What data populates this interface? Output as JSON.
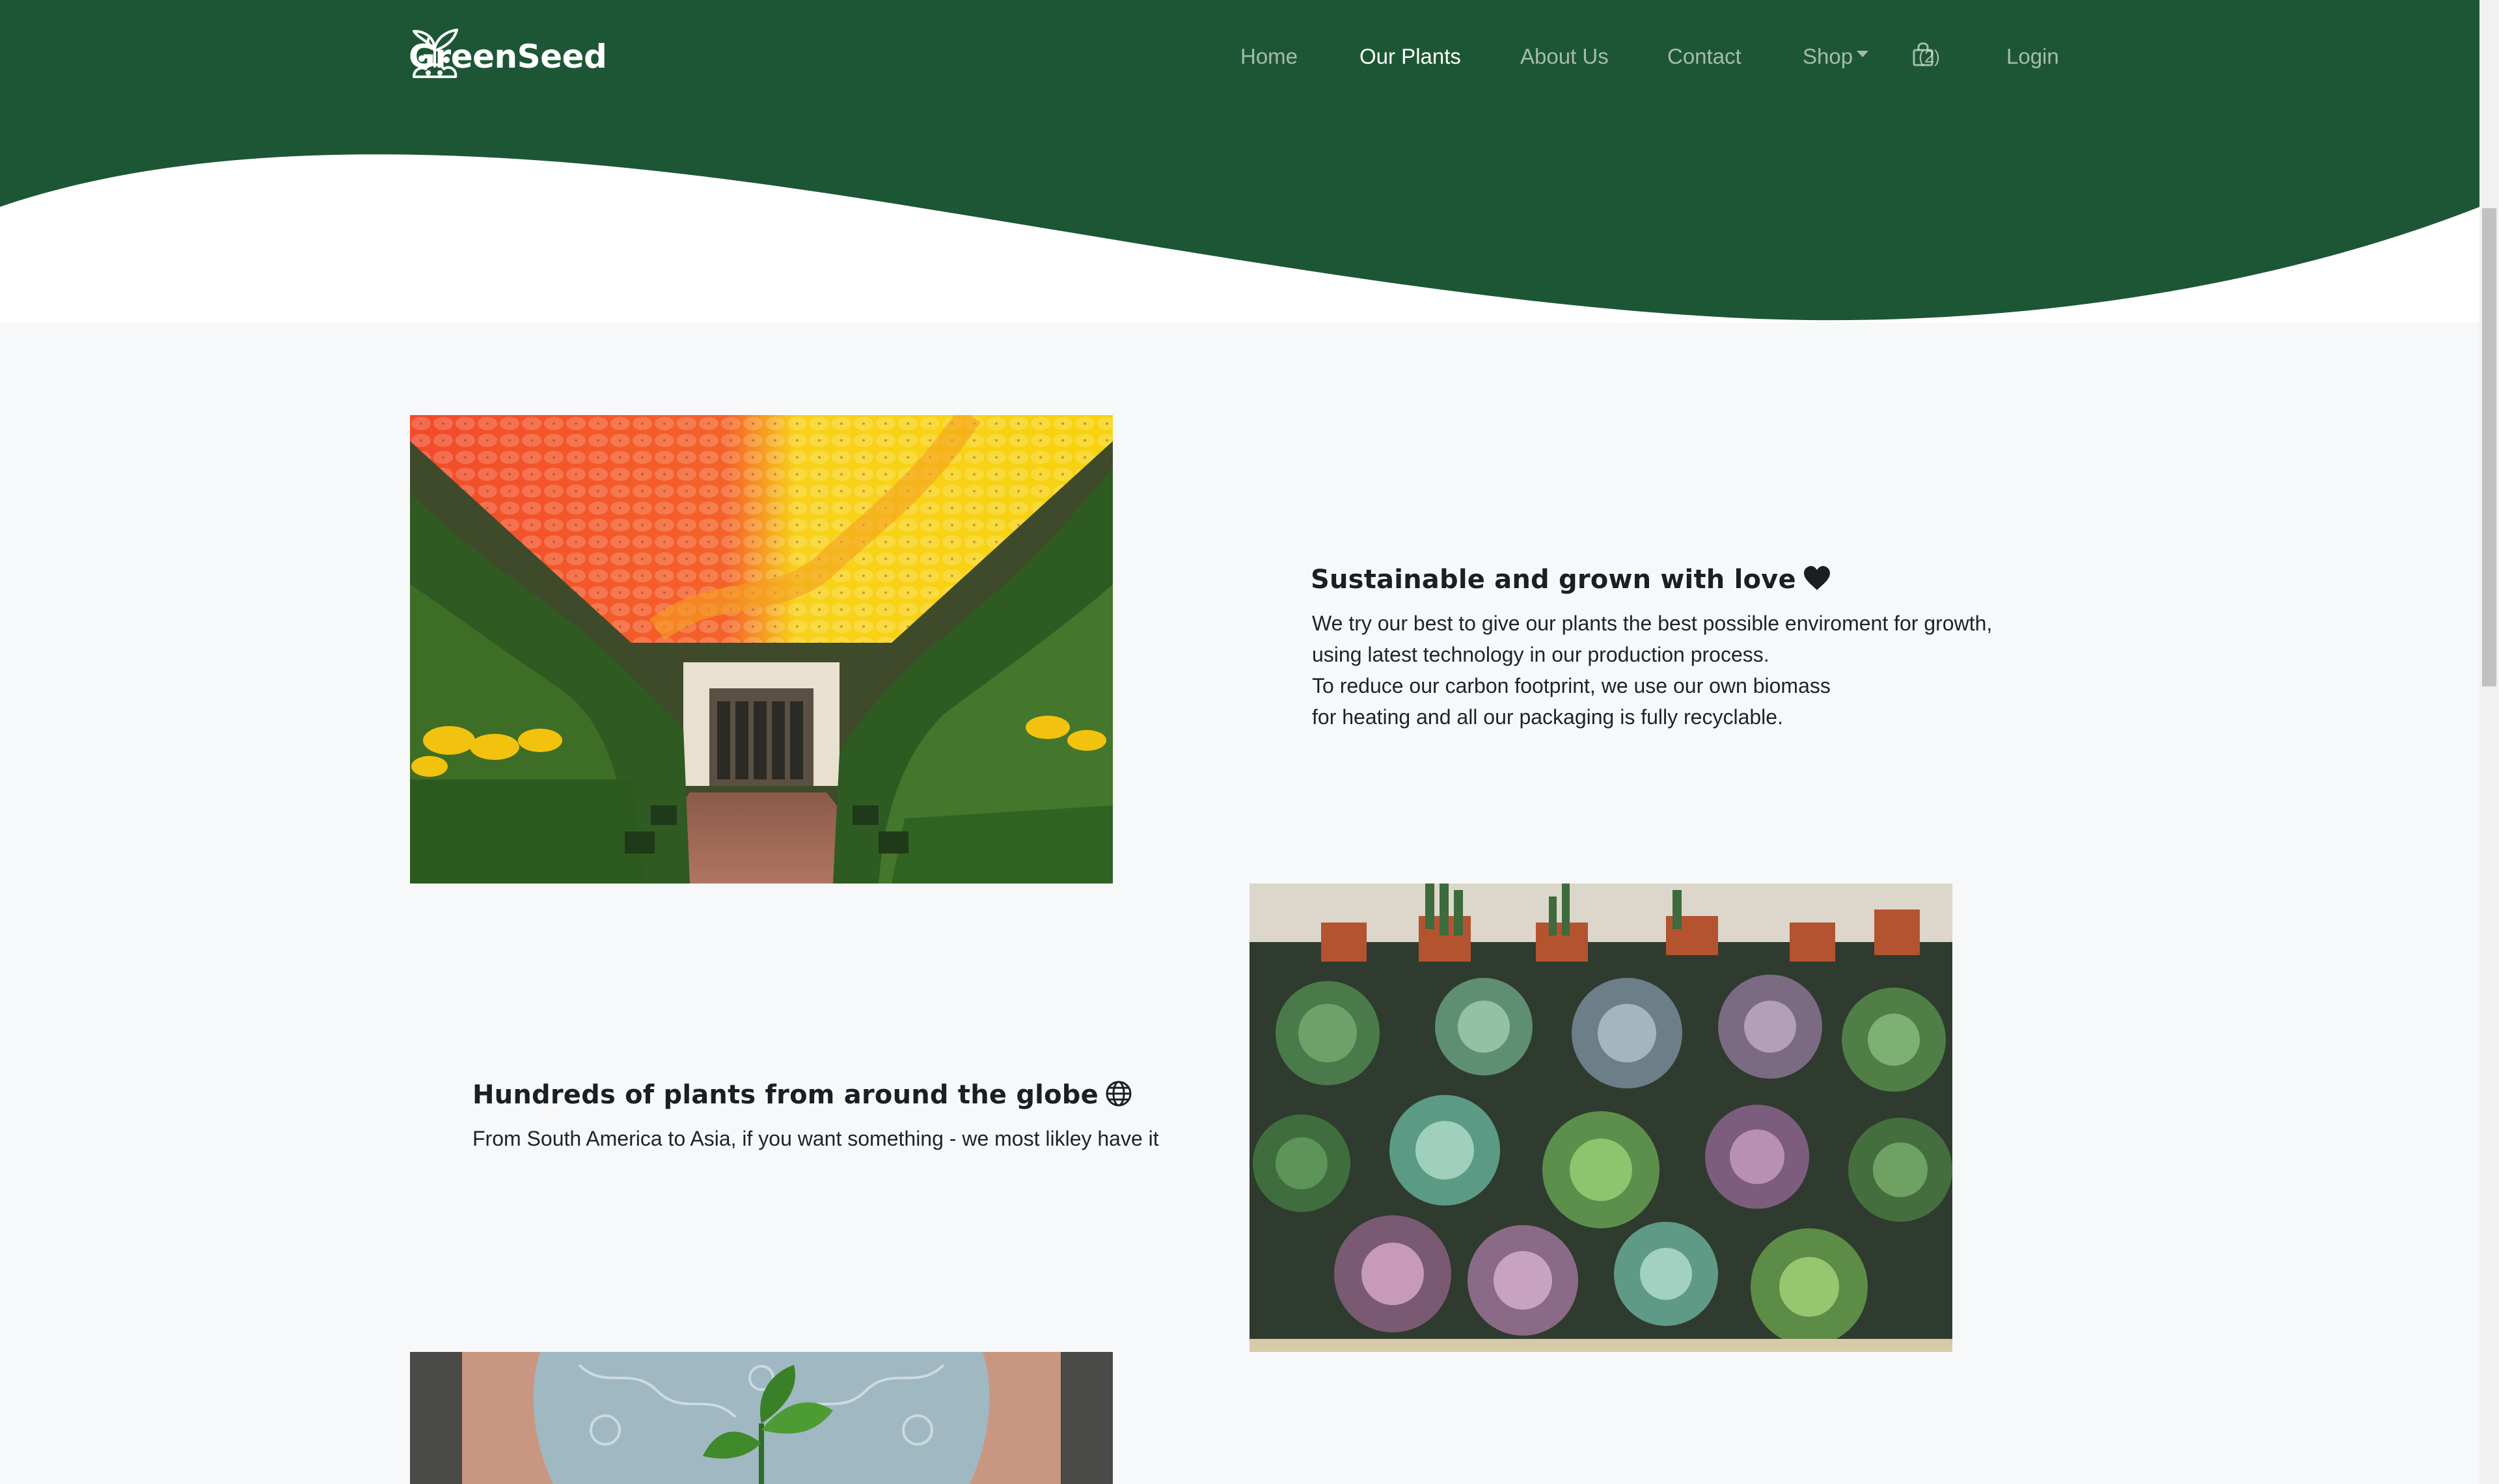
{
  "brand": {
    "name": "GreenSeed",
    "logo_icon": "plant-sprout-icon"
  },
  "nav": {
    "items": [
      {
        "label": "Home",
        "active": false
      },
      {
        "label": "Our Plants",
        "active": true
      },
      {
        "label": "About Us",
        "active": false
      },
      {
        "label": "Contact",
        "active": false
      }
    ],
    "shop_label": "Shop",
    "cart_icon": "shopping-bag-icon",
    "cart_count": "(2)",
    "login_label": "Login"
  },
  "colors": {
    "header_green": "#1d5635",
    "page_background": "#f7f8fa",
    "text_dark": "#1f2326"
  },
  "features": [
    {
      "title": "Sustainable and grown with love",
      "title_icon": "heart-icon",
      "lines": [
        "We try our best to give our plants the best possible enviroment for growth,",
        "using latest technology in our production process.",
        "To reduce our carbon footprint, we use our own biomass",
        "for heating and all our packaging is fully recyclable."
      ]
    },
    {
      "title": "Hundreds of plants from around the globe",
      "title_icon": "globe-icon",
      "lines": [
        "From South America to Asia, if you want something - we most likley have it"
      ]
    }
  ],
  "images": {
    "greenhouse": "greenhouse-umbrella-canopy-image",
    "succulents": "potted-succulents-image",
    "seedling": "hands-holding-seedling-image"
  }
}
